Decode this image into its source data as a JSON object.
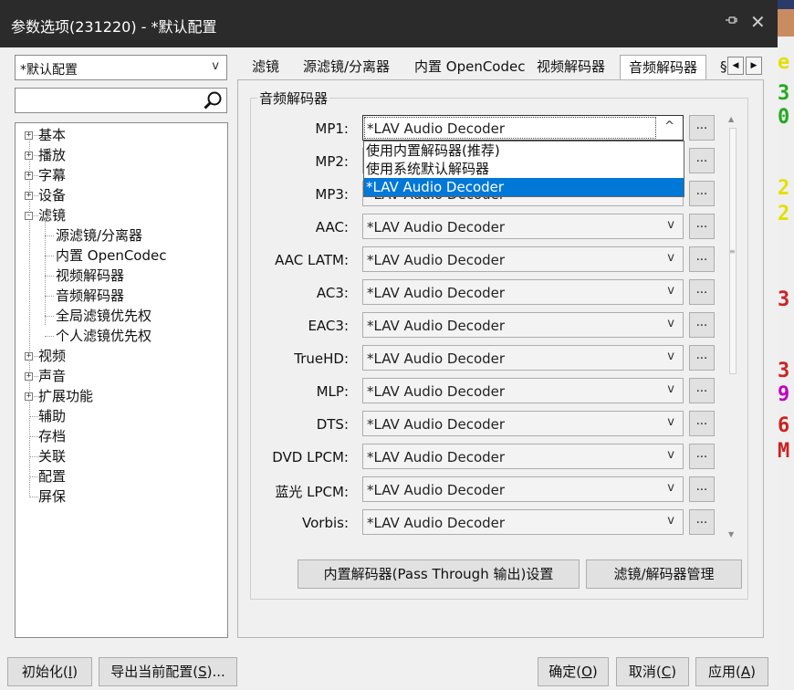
{
  "window": {
    "title": "参数选项(231220) - *默认配置",
    "pin_icon": "pin-icon",
    "close_icon": "close-icon"
  },
  "profile_select": {
    "value": "*默认配置"
  },
  "search": {
    "value": "",
    "icon": "search-icon"
  },
  "tree": {
    "items": [
      {
        "label": "基本",
        "expander": "+"
      },
      {
        "label": "播放",
        "expander": "+"
      },
      {
        "label": "字幕",
        "expander": "+"
      },
      {
        "label": "设备",
        "expander": "+"
      },
      {
        "label": "滤镜",
        "expander": "-"
      },
      {
        "label": "源滤镜/分离器"
      },
      {
        "label": "内置 OpenCodec"
      },
      {
        "label": "视频解码器"
      },
      {
        "label": "音频解码器"
      },
      {
        "label": "全局滤镜优先权"
      },
      {
        "label": "个人滤镜优先权"
      },
      {
        "label": "视频",
        "expander": "+"
      },
      {
        "label": "声音",
        "expander": "+"
      },
      {
        "label": "扩展功能",
        "expander": "+"
      },
      {
        "label": "辅助"
      },
      {
        "label": "存档"
      },
      {
        "label": "关联"
      },
      {
        "label": "配置"
      },
      {
        "label": "屏保"
      }
    ]
  },
  "tabs": [
    {
      "label": "滤镜"
    },
    {
      "label": "源滤镜/分离器"
    },
    {
      "label": "内置 OpenCodec"
    },
    {
      "label": "视频解码器"
    },
    {
      "label": "音频解码器",
      "active": true
    },
    {
      "label": "§"
    }
  ],
  "tab_nav": {
    "prev": "◀",
    "next": "▶"
  },
  "group": {
    "title": "音频解码器",
    "more_label": "...",
    "rows": [
      {
        "label": "MP1:",
        "value": "*LAV Audio Decoder",
        "arrow": "^"
      },
      {
        "label": "MP2:",
        "value": "*LAV Audio Decoder",
        "arrow": "v"
      },
      {
        "label": "MP3:",
        "value": "*LAV Audio Decoder",
        "arrow": "v"
      },
      {
        "label": "AAC:",
        "value": "*LAV Audio Decoder",
        "arrow": "v"
      },
      {
        "label": "AAC LATM:",
        "value": "*LAV Audio Decoder",
        "arrow": "v"
      },
      {
        "label": "AC3:",
        "value": "*LAV Audio Decoder",
        "arrow": "v"
      },
      {
        "label": "EAC3:",
        "value": "*LAV Audio Decoder",
        "arrow": "v"
      },
      {
        "label": "TrueHD:",
        "value": "*LAV Audio Decoder",
        "arrow": "v"
      },
      {
        "label": "MLP:",
        "value": "*LAV Audio Decoder",
        "arrow": "v"
      },
      {
        "label": "DTS:",
        "value": "*LAV Audio Decoder",
        "arrow": "v"
      },
      {
        "label": "DVD LPCM:",
        "value": "*LAV Audio Decoder",
        "arrow": "v"
      },
      {
        "label": "蓝光 LPCM:",
        "value": "*LAV Audio Decoder",
        "arrow": "v"
      },
      {
        "label": "Vorbis:",
        "value": "*LAV Audio Decoder",
        "arrow": "v"
      }
    ],
    "dropdown_options": [
      {
        "label": "使用内置解码器(推荐)"
      },
      {
        "label": "使用系统默认解码器"
      },
      {
        "label": "*LAV Audio Decoder",
        "selected": true
      }
    ],
    "passthrough_button": "内置解码器(Pass Through 输出)设置",
    "manager_button": "滤镜/解码器管理"
  },
  "footer": {
    "reset": {
      "text": "初始化(",
      "key": "I",
      "end": ")"
    },
    "export": {
      "text": "导出当前配置(",
      "key": "S",
      "end": ")..."
    },
    "ok": {
      "text": "确定(",
      "key": "O",
      "end": ")"
    },
    "cancel": {
      "text": "取消(",
      "key": "C",
      "end": ")"
    },
    "apply": {
      "text": "应用(",
      "key": "A",
      "end": ")"
    }
  },
  "background_glyphs": [
    {
      "char": "e",
      "color": "#e3e000"
    },
    {
      "char": "3",
      "color": "#22aa22"
    },
    {
      "char": "0",
      "color": "#22aa22"
    },
    {
      "char": "2",
      "color": "#e3e000"
    },
    {
      "char": "2",
      "color": "#e3e000"
    },
    {
      "char": "3",
      "color": "#cc2222"
    },
    {
      "char": "3",
      "color": "#cc2222"
    },
    {
      "char": "9",
      "color": "#c000c0"
    },
    {
      "char": "6",
      "color": "#cc2222"
    },
    {
      "char": "M",
      "color": "#cc2222"
    }
  ],
  "colors": {
    "selection": "#0078d7",
    "titlebar": "#2b2b2b"
  }
}
